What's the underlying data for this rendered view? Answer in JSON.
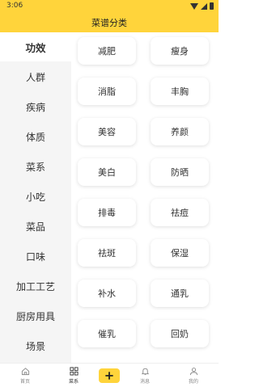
{
  "status_bar": {
    "time": "3:06"
  },
  "header": {
    "title": "菜谱分类"
  },
  "sidebar": {
    "items": [
      {
        "label": "功效",
        "active": true
      },
      {
        "label": "人群"
      },
      {
        "label": "疾病"
      },
      {
        "label": "体质"
      },
      {
        "label": "菜系"
      },
      {
        "label": "小吃"
      },
      {
        "label": "菜品"
      },
      {
        "label": "口味"
      },
      {
        "label": "加工工艺"
      },
      {
        "label": "厨房用具"
      },
      {
        "label": "场景"
      }
    ]
  },
  "tags": [
    "减肥",
    "瘦身",
    "消脂",
    "丰胸",
    "美容",
    "养颜",
    "美白",
    "防晒",
    "排毒",
    "祛痘",
    "祛斑",
    "保湿",
    "补水",
    "通乳",
    "催乳",
    "回奶"
  ],
  "bottom_nav": {
    "items": [
      {
        "label": "首页",
        "icon": "home-icon"
      },
      {
        "label": "菜系",
        "icon": "grid-icon",
        "active": true
      },
      {
        "label": "",
        "icon": "plus-icon"
      },
      {
        "label": "消息",
        "icon": "bell-icon"
      },
      {
        "label": "我的",
        "icon": "user-icon"
      }
    ]
  },
  "colors": {
    "accent": "#ffd43b",
    "sidebar_bg": "#f5f5f5"
  }
}
